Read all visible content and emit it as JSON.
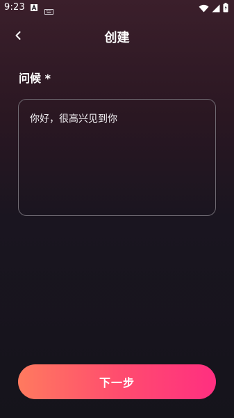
{
  "status_bar": {
    "time": "9:23"
  },
  "header": {
    "title": "创建"
  },
  "form": {
    "greeting_label": "问候 *",
    "greeting_value": "你好，很高兴见到你"
  },
  "actions": {
    "next_label": "下一步"
  },
  "colors": {
    "accent_start": "#ff7a5f",
    "accent_end": "#ff2f80",
    "background_top": "#3b1f2b",
    "background_bottom": "#15141b",
    "input_border": "#6f6a72"
  },
  "icons": {
    "back": "chevron-left-icon",
    "wifi": "wifi-icon",
    "signal": "signal-icon",
    "battery": "battery-icon",
    "notification_a": "text-a-icon",
    "keyboard": "keyboard-icon"
  }
}
